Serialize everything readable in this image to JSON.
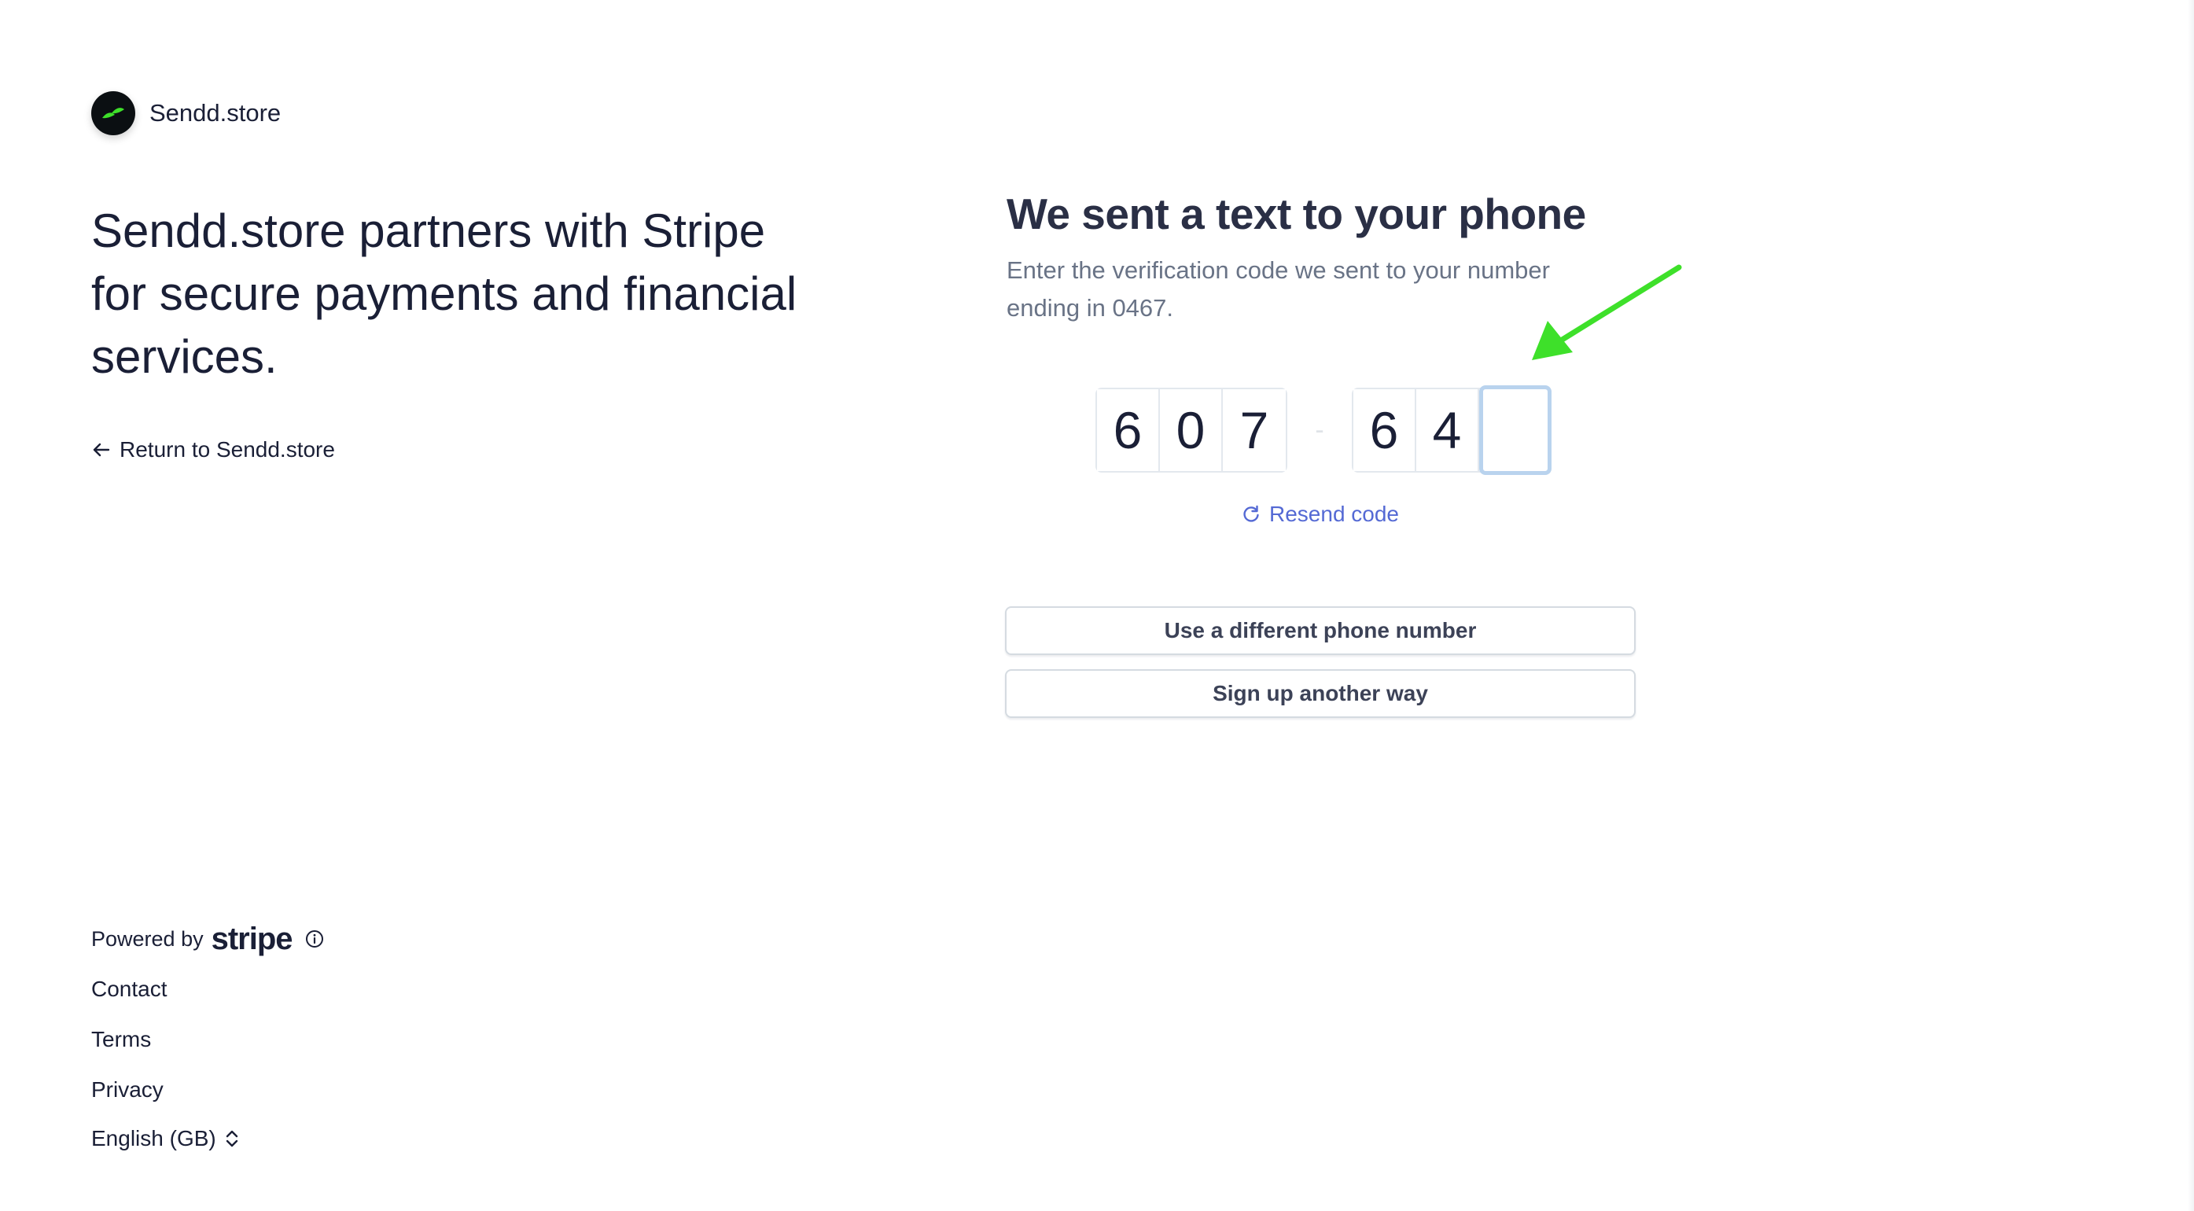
{
  "brand": {
    "name": "Sendd.store",
    "logo_colors": {
      "background": "#0b0f12",
      "accent": "#3ee02a"
    }
  },
  "left": {
    "headline": "Sendd.store partners with Stripe for secure payments and financial services.",
    "return_link": "Return to Sendd.store",
    "return_icon": "arrow-left-icon"
  },
  "verify": {
    "title": "We sent a text to your phone",
    "description": "Enter the verification code we sent to your number ending in 0467.",
    "code_digits": [
      "6",
      "0",
      "7",
      "6",
      "4",
      ""
    ],
    "separator": "-",
    "resend_label": "Resend code",
    "resend_icon": "refresh-icon",
    "buttons": {
      "different_phone": "Use a different phone number",
      "another_way": "Sign up another way"
    }
  },
  "footer": {
    "powered_by": "Powered by",
    "stripe": "stripe",
    "links": [
      "Contact",
      "Terms",
      "Privacy"
    ],
    "language": "English (GB)"
  },
  "colors": {
    "text_primary": "#1a1f36",
    "text_secondary": "#697386",
    "link": "#5469d4",
    "focus_border": "#b9d3ee",
    "annotation_arrow": "#3ee02a"
  }
}
